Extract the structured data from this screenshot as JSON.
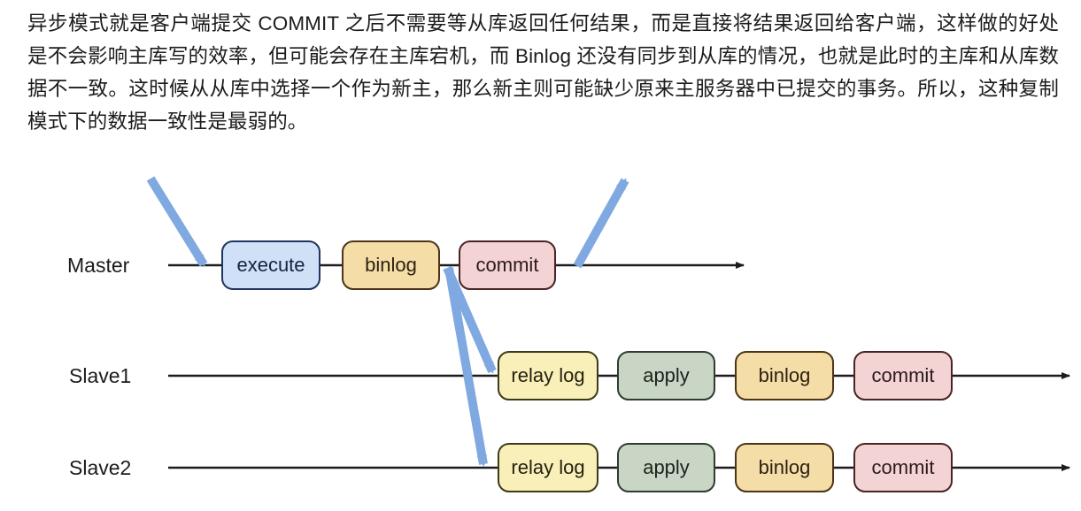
{
  "paragraph": {
    "text": "异步模式就是客户端提交 COMMIT 之后不需要等从库返回任何结果，而是直接将结果返回给客户端，这样做的好处是不会影响主库写的效率，但可能会存在主库宕机，而 Binlog 还没有同步到从库的情况，也就是此时的主库和从库数据不一致。这时候从从库中选择一个作为新主，那么新主则可能缺少原来主服务器中已提交的事务。所以，这种复制模式下的数据一致性是最弱的。"
  },
  "diagram": {
    "colors": {
      "timeline": "#1c1c1c",
      "blue_arrow": "#7fa9e0",
      "execute_fill": "#cfe0f7",
      "binlog_fill": "#f5dda8",
      "commit_fill": "#f3d3d3",
      "relaylog_fill": "#f8efb9",
      "apply_fill": "#c9d6c6"
    },
    "rows": [
      {
        "label": "Master",
        "nodes": [
          {
            "label": "execute",
            "kind": "execute"
          },
          {
            "label": "binlog",
            "kind": "binlog"
          },
          {
            "label": "commit",
            "kind": "commit"
          }
        ]
      },
      {
        "label": "Slave1",
        "nodes": [
          {
            "label": "relay log",
            "kind": "relaylog"
          },
          {
            "label": "apply",
            "kind": "apply"
          },
          {
            "label": "binlog",
            "kind": "binlog"
          },
          {
            "label": "commit",
            "kind": "commit"
          }
        ]
      },
      {
        "label": "Slave2",
        "nodes": [
          {
            "label": "relay log",
            "kind": "relaylog"
          },
          {
            "label": "apply",
            "kind": "apply"
          },
          {
            "label": "binlog",
            "kind": "binlog"
          },
          {
            "label": "commit",
            "kind": "commit"
          }
        ]
      }
    ],
    "annotations": {
      "client_commit_in": "incoming-commit-arrow",
      "client_result_out": "outgoing-result-arrow",
      "replicate_slave1": "binlog-to-slave1-arrow",
      "replicate_slave2": "binlog-to-slave2-arrow"
    }
  }
}
